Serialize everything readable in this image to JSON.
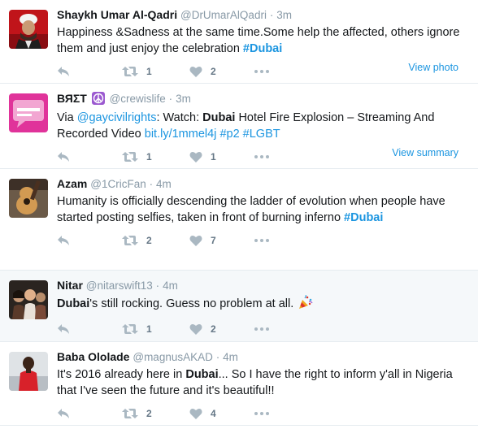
{
  "tweets": [
    {
      "name": "Shaykh Umar Al-Qadri",
      "handle": "@DrUmarAlQadri",
      "dot": "·",
      "time": "3m",
      "text_parts": [
        {
          "t": "Happiness &Sadness at the same time.Some help the affected, others ignore them and just enjoy the celebration ",
          "s": "plain"
        },
        {
          "t": "#Dubai",
          "s": "tag"
        }
      ],
      "retweets": "1",
      "likes": "2",
      "view_label": "View photo",
      "avatar": "man-red-background-avatar"
    },
    {
      "name": "ВЯΣТ",
      "handle": "@crewislife",
      "dot": "·",
      "time": "3m",
      "badge_icon": "peace-sign-icon",
      "text_parts": [
        {
          "t": "Via ",
          "s": "plain"
        },
        {
          "t": "@gaycivilrights",
          "s": "link"
        },
        {
          "t": ": Watch: ",
          "s": "plain"
        },
        {
          "t": "Dubai",
          "s": "b"
        },
        {
          "t": " Hotel Fire Explosion – Streaming And Recorded Video ",
          "s": "plain"
        },
        {
          "t": "bit.ly/1mmel4j",
          "s": "link"
        },
        {
          "t": " ",
          "s": "plain"
        },
        {
          "t": "#p2",
          "s": "link"
        },
        {
          "t": " ",
          "s": "plain"
        },
        {
          "t": "#LGBT",
          "s": "link"
        }
      ],
      "retweets": "1",
      "likes": "1",
      "view_label": "View summary",
      "avatar": "pink-chat-bubble-avatar"
    },
    {
      "name": "Azam",
      "handle": "@1CricFan",
      "dot": "·",
      "time": "4m",
      "text_parts": [
        {
          "t": "Humanity is officially descending the ladder of evolution when people have started posting selfies, taken in front of burning inferno ",
          "s": "plain"
        },
        {
          "t": "#Dubai",
          "s": "tag"
        }
      ],
      "retweets": "2",
      "likes": "7",
      "view_label": "",
      "avatar": "guitar-avatar"
    },
    {
      "name": "Nitar",
      "handle": "@nitarswift13",
      "dot": "·",
      "time": "4m",
      "text_parts": [
        {
          "t": "Dubai",
          "s": "b"
        },
        {
          "t": "'s still rocking. Guess no problem at all. ",
          "s": "plain"
        }
      ],
      "emoji": "party-popper-icon",
      "retweets": "1",
      "likes": "2",
      "view_label": "",
      "avatar": "group-photo-avatar"
    },
    {
      "name": "Baba Ololade",
      "handle": "@magnusAKAD",
      "dot": "·",
      "time": "4m",
      "text_parts": [
        {
          "t": "It's 2016 already here in ",
          "s": "plain"
        },
        {
          "t": "Dubai",
          "s": "b"
        },
        {
          "t": "... So I have the right to inform y'all in Nigeria that I've seen the future and it's beautiful!!",
          "s": "plain"
        }
      ],
      "retweets": "2",
      "likes": "4",
      "view_label": "",
      "avatar": "person-red-outfit-avatar"
    }
  ],
  "colors": {
    "link": "#1b95e0",
    "muted": "#8899a6",
    "icon": "#aab8c2",
    "highlight_bg": "#f5f8fa"
  }
}
